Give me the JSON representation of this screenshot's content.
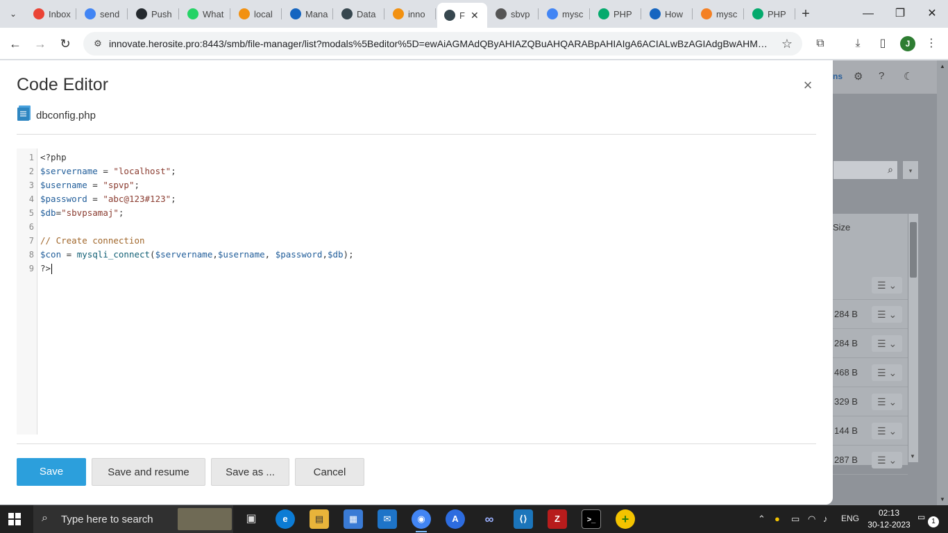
{
  "browser": {
    "tabs": [
      {
        "label": "Inbox",
        "icon": "gmail-icon",
        "color": "#ea4335"
      },
      {
        "label": "send",
        "icon": "google-icon",
        "color": "#4285f4"
      },
      {
        "label": "Push",
        "icon": "github-icon",
        "color": "#24292e"
      },
      {
        "label": "What",
        "icon": "whatsapp-icon",
        "color": "#25d366"
      },
      {
        "label": "local",
        "icon": "phpmyadmin-icon",
        "color": "#f29111"
      },
      {
        "label": "Mana",
        "icon": "m-icon",
        "color": "#1565c0"
      },
      {
        "label": "Data",
        "icon": "p-icon",
        "color": "#37474f"
      },
      {
        "label": "inno",
        "icon": "phpmyadmin-icon",
        "color": "#f29111"
      },
      {
        "label": "F",
        "icon": "p-icon",
        "color": "#37474f",
        "active": true
      },
      {
        "label": "sbvp",
        "icon": "globe-icon",
        "color": "#555555"
      },
      {
        "label": "mysc",
        "icon": "google-icon",
        "color": "#4285f4"
      },
      {
        "label": "PHP",
        "icon": "w3schools-icon",
        "color": "#04aa6d"
      },
      {
        "label": "How",
        "icon": "m-icon",
        "color": "#1565c0"
      },
      {
        "label": "mysc",
        "icon": "stackoverflow-icon",
        "color": "#f48024"
      },
      {
        "label": "PHP",
        "icon": "w3schools-icon",
        "color": "#04aa6d"
      }
    ],
    "url": "innovate.herosite.pro:8443/smb/file-manager/list?modals%5Beditor%5D=ewAiAGMAdQByAHIAZQBuAHQARABpAHIAIgA6ACIALwBzAGIAdgBwAHMAYQ...",
    "profile_initial": "J"
  },
  "background_page": {
    "size_header": "Size",
    "sizes": [
      "284 B",
      "284 B",
      "468 B",
      "329 B",
      "144 B",
      "287 B"
    ]
  },
  "modal": {
    "title": "Code Editor",
    "file_name": "dbconfig.php",
    "code_lines": [
      "<?php",
      "$servername = \"localhost\";",
      "$username = \"spvp\";",
      "$password = \"abc@123#123\";",
      "$db=\"sbvpsamaj\";",
      "",
      "// Create connection",
      "$con = mysqli_connect($servername,$username, $password,$db);",
      "?>"
    ],
    "line_numbers": [
      "1",
      "2",
      "3",
      "4",
      "5",
      "6",
      "7",
      "8",
      "9"
    ],
    "buttons": {
      "save": "Save",
      "save_resume": "Save and resume",
      "save_as": "Save as ...",
      "cancel": "Cancel"
    }
  },
  "taskbar": {
    "search_placeholder": "Type here to search",
    "language": "ENG",
    "time": "02:13",
    "date": "30-12-2023",
    "notification_count": "1"
  }
}
